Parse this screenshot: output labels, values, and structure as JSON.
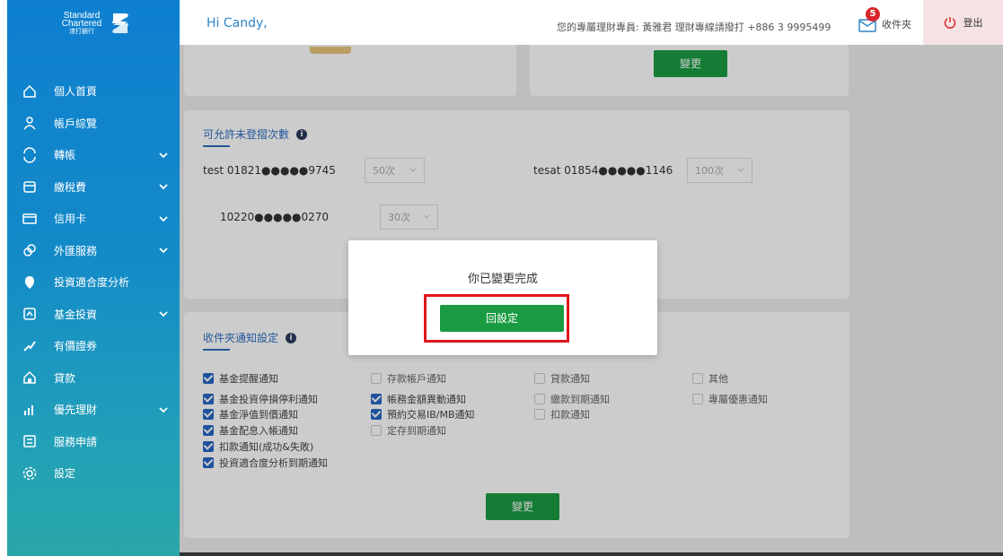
{
  "brand": {
    "logo_line1": "Standard",
    "logo_line2": "Chartered",
    "logo_zh": "渣打銀行"
  },
  "sidebar": {
    "items": [
      {
        "label": "個人首頁",
        "icon": "home-icon",
        "chevron": false
      },
      {
        "label": "帳戶綜覽",
        "icon": "user-icon",
        "chevron": false
      },
      {
        "label": "轉帳",
        "icon": "transfer-icon",
        "chevron": true
      },
      {
        "label": "繳稅費",
        "icon": "wallet-icon",
        "chevron": true
      },
      {
        "label": "信用卡",
        "icon": "credit-card-icon",
        "chevron": true
      },
      {
        "label": "外匯服務",
        "icon": "exchange-icon",
        "chevron": true
      },
      {
        "label": "投資適合度分析",
        "icon": "shield-icon",
        "chevron": false
      },
      {
        "label": "基金投資",
        "icon": "fund-icon",
        "chevron": true
      },
      {
        "label": "有價證券",
        "icon": "securities-icon",
        "chevron": false
      },
      {
        "label": "貸款",
        "icon": "house-icon",
        "chevron": false
      },
      {
        "label": "優先理財",
        "icon": "chart-icon",
        "chevron": true
      },
      {
        "label": "服務申請",
        "icon": "form-icon",
        "chevron": false
      },
      {
        "label": "設定",
        "icon": "gear-icon",
        "chevron": false
      }
    ]
  },
  "header": {
    "greeting": "Hi Candy,",
    "advisor": "您的專屬理財專員: 黃雅君 理財專線請撥打 +886 3 9995499",
    "inbox_count": "5",
    "inbox_label": "收件夾",
    "logout_label": "登出"
  },
  "top_cards": {
    "change_label": "變更"
  },
  "login_attempts": {
    "title": "可允許未登摺次數",
    "accounts": [
      {
        "name": "test 01821●●●●●9745",
        "value": "50次"
      },
      {
        "name": "tesat 01854●●●●●1146",
        "value": "100次"
      },
      {
        "name": "10220●●●●●0270",
        "value": "30次"
      }
    ]
  },
  "inbox_settings": {
    "title": "收件夾通知設定",
    "change_label": "變更",
    "columns": [
      [
        {
          "label": "基金提醒通知",
          "checked": true
        },
        {
          "label": "基金投資停損停利通知",
          "checked": true
        },
        {
          "label": "基金淨值到價通知",
          "checked": true
        },
        {
          "label": "基金配息入帳通知",
          "checked": true
        },
        {
          "label": "扣款通知(成功&失敗)",
          "checked": true
        },
        {
          "label": "投資適合度分析到期通知",
          "checked": true
        }
      ],
      [
        {
          "label": "存款帳戶通知",
          "checked": false
        },
        {
          "label": "帳務金額異動通知",
          "checked": true
        },
        {
          "label": "預約交易IB/MB通知",
          "checked": true
        },
        {
          "label": "定存到期通知",
          "checked": false
        }
      ],
      [
        {
          "label": "貸款通知",
          "checked": false
        },
        {
          "label": "繳款到期通知",
          "checked": false
        },
        {
          "label": "扣款通知",
          "checked": false
        }
      ],
      [
        {
          "label": "其他",
          "checked": false
        },
        {
          "label": "專屬優惠通知",
          "checked": false
        }
      ]
    ]
  },
  "modal": {
    "message": "你已變更完成",
    "button": "回設定"
  },
  "colors": {
    "primary_green": "#1a9b42",
    "link_blue": "#2f6fc4",
    "highlight_red": "#e0161c",
    "badge_red": "#d9262b"
  }
}
